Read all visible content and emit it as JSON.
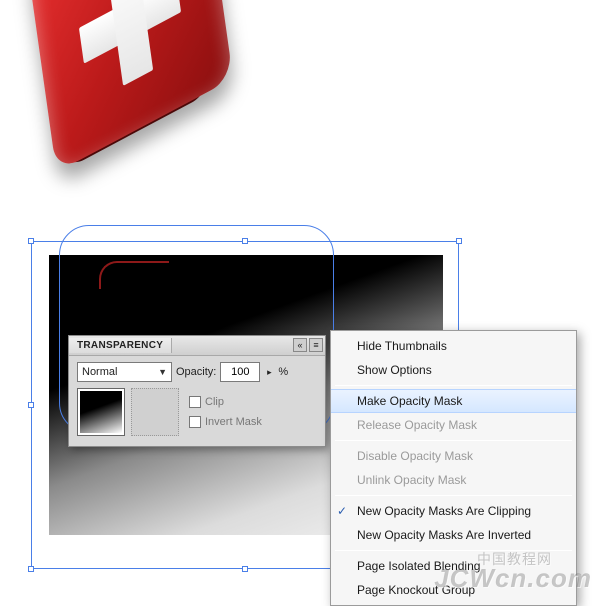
{
  "panel": {
    "title": "TRANSPARENCY",
    "blend_mode": "Normal",
    "opacity_label": "Opacity:",
    "opacity_value": "100",
    "opacity_suffix": "%",
    "clip_label": "Clip",
    "invert_label": "Invert Mask",
    "flyout_icon": "≡",
    "collapse_icon": "«",
    "close_icon_alt": "panel-close"
  },
  "menu": {
    "items": [
      {
        "label": "Hide Thumbnails",
        "state": "enabled"
      },
      {
        "label": "Show Options",
        "state": "enabled"
      },
      {
        "label": "Make Opacity Mask",
        "state": "hover"
      },
      {
        "label": "Release Opacity Mask",
        "state": "disabled"
      },
      {
        "label": "Disable Opacity Mask",
        "state": "disabled"
      },
      {
        "label": "Unlink Opacity Mask",
        "state": "disabled"
      },
      {
        "label": "New Opacity Masks Are Clipping",
        "state": "checked"
      },
      {
        "label": "New Opacity Masks Are Inverted",
        "state": "enabled"
      },
      {
        "label": "Page Isolated Blending",
        "state": "enabled"
      },
      {
        "label": "Page Knockout Group",
        "state": "enabled"
      }
    ]
  },
  "watermark": {
    "main": "JCWcn.com",
    "sub": "中国教程网"
  },
  "colors": {
    "selection": "#4a7fe8"
  }
}
